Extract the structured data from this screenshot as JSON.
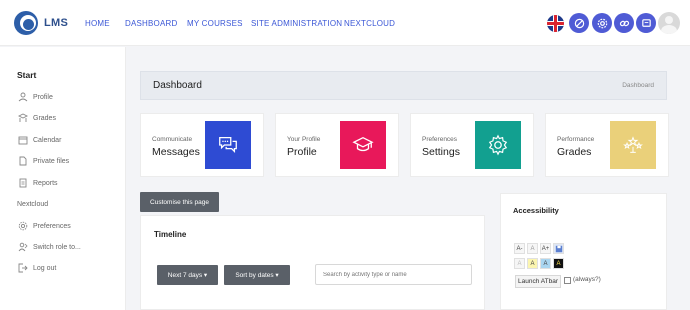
{
  "brand": "LMS",
  "nav": {
    "home": "HOME",
    "dashboard": "DASHBOARD",
    "courses": "MY COURSES",
    "admin": "SITE ADMINISTRATION",
    "nextcloud": "NEXTCLOUD"
  },
  "topbar_icons": [
    "flag-uk-icon",
    "accessibility-icon",
    "gear-icon",
    "link-icon",
    "chat-icon",
    "user-avatar"
  ],
  "sidebar": {
    "start": "Start",
    "items": [
      {
        "label": "Profile",
        "icon": "profile-icon"
      },
      {
        "label": "Grades",
        "icon": "grades-icon"
      },
      {
        "label": "Calendar",
        "icon": "calendar-icon"
      },
      {
        "label": "Private files",
        "icon": "file-icon"
      },
      {
        "label": "Reports",
        "icon": "reports-icon"
      }
    ],
    "nextcloud": "Nextcloud",
    "items2": [
      {
        "label": "Preferences",
        "icon": "gear-icon"
      },
      {
        "label": "Switch role to...",
        "icon": "switch-role-icon"
      },
      {
        "label": "Log out",
        "icon": "logout-icon"
      }
    ]
  },
  "header": {
    "title": "Dashboard",
    "breadcrumb": "Dashboard"
  },
  "cards": [
    {
      "small": "Communicate",
      "big": "Messages",
      "color": "#2e4bd3",
      "icon": "messages-icon"
    },
    {
      "small": "Your Profile",
      "big": "Profile",
      "color": "#e8185a",
      "icon": "graduation-cap-icon"
    },
    {
      "small": "Preferences",
      "big": "Settings",
      "color": "#12a090",
      "icon": "gear-icon"
    },
    {
      "small": "Performance",
      "big": "Grades",
      "color": "#ead07a",
      "icon": "stars-icon"
    }
  ],
  "customise": "Customise this page",
  "timeline": {
    "title": "Timeline",
    "next_btn": "Next 7 days ▾",
    "sort_btn": "Sort by dates ▾",
    "search_placeholder": "Search by activity type or name"
  },
  "accessibility": {
    "title": "Accessibility",
    "row1": [
      "A-",
      "A",
      "A+"
    ],
    "row2": [
      "A",
      "A",
      "A",
      "A"
    ],
    "launch": "Launch ATbar",
    "always": "(always?)"
  }
}
